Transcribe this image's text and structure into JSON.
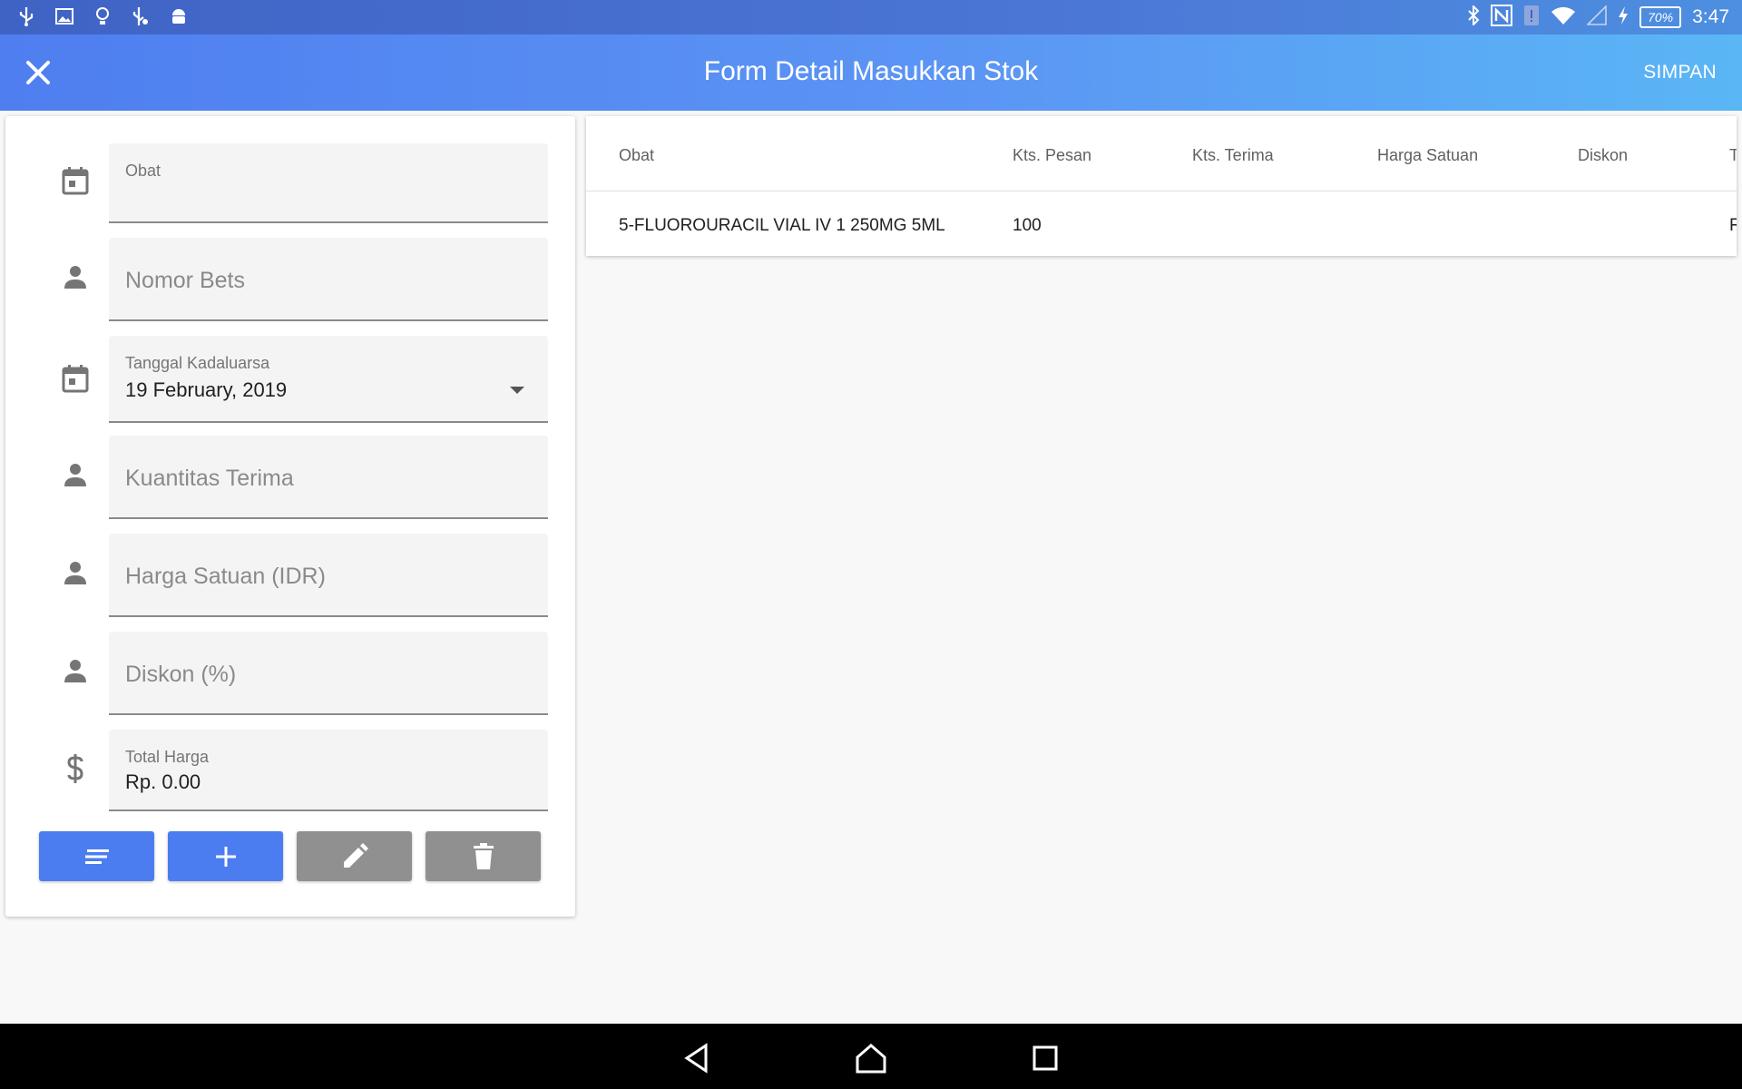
{
  "status_bar": {
    "left_icons": [
      "usb-icon",
      "image-icon",
      "lightbulb-icon",
      "usb-debug-icon",
      "android-icon"
    ],
    "right_icons": [
      "bluetooth-icon",
      "nfc-icon",
      "alert-icon",
      "wifi-icon",
      "signal-icon",
      "charging-icon"
    ],
    "battery": "70%",
    "time": "3:47"
  },
  "app_bar": {
    "title": "Form Detail Masukkan Stok",
    "save_label": "SIMPAN"
  },
  "form": {
    "obat": {
      "label": "Obat",
      "value": ""
    },
    "nomor_bets": {
      "placeholder": "Nomor Bets"
    },
    "tanggal_kadaluarsa": {
      "label": "Tanggal Kadaluarsa",
      "value": "19 February, 2019"
    },
    "kuantitas_terima": {
      "placeholder": "Kuantitas Terima"
    },
    "harga_satuan": {
      "placeholder": "Harga Satuan (IDR)"
    },
    "diskon": {
      "placeholder": "Diskon (%)"
    },
    "total_harga": {
      "label": "Total Harga",
      "value": "Rp. 0.00"
    }
  },
  "buttons": [
    "list-icon",
    "add-icon",
    "edit-icon",
    "delete-icon"
  ],
  "table": {
    "headers": [
      "Obat",
      "Kts. Pesan",
      "Kts. Terima",
      "Harga Satuan",
      "Diskon",
      "T"
    ],
    "rows": [
      [
        "5-FLUOROURACIL VIAL IV 1 250MG 5ML",
        "100",
        "",
        "",
        "",
        "R"
      ]
    ]
  },
  "colors": {
    "primary": "#4b7df0",
    "disabled": "#909090"
  }
}
